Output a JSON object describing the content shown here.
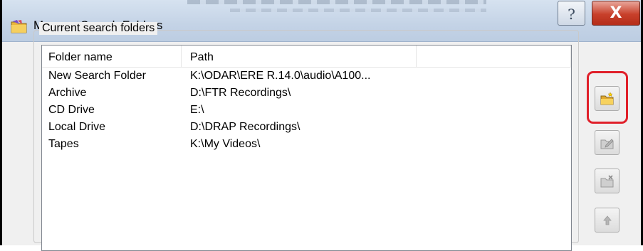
{
  "window": {
    "title": "Manage Search Folders",
    "help_glyph": "?",
    "close_glyph": "X"
  },
  "group": {
    "label": "Current search folders"
  },
  "table": {
    "columns": [
      "Folder name",
      "Path",
      ""
    ],
    "rows": [
      {
        "name": "New Search Folder",
        "path": "K:\\ODAR\\ERE R.14.0\\audio\\A100..."
      },
      {
        "name": "Archive",
        "path": "D:\\FTR Recordings\\"
      },
      {
        "name": "CD Drive",
        "path": "E:\\"
      },
      {
        "name": "Local Drive",
        "path": "D:\\DRAP Recordings\\"
      },
      {
        "name": "Tapes",
        "path": "K:\\My Videos\\"
      }
    ]
  },
  "buttons": {
    "add": {
      "icon": "new-folder-icon",
      "highlighted": true,
      "enabled": true
    },
    "edit": {
      "icon": "edit-folder-icon",
      "enabled": false
    },
    "delete": {
      "icon": "delete-folder-icon",
      "enabled": false
    },
    "move_up": {
      "icon": "arrow-up-icon",
      "enabled": false
    }
  },
  "colors": {
    "highlight": "#e0202a",
    "close_button": "#c8402b",
    "titlebar": "#c4d3e6"
  }
}
